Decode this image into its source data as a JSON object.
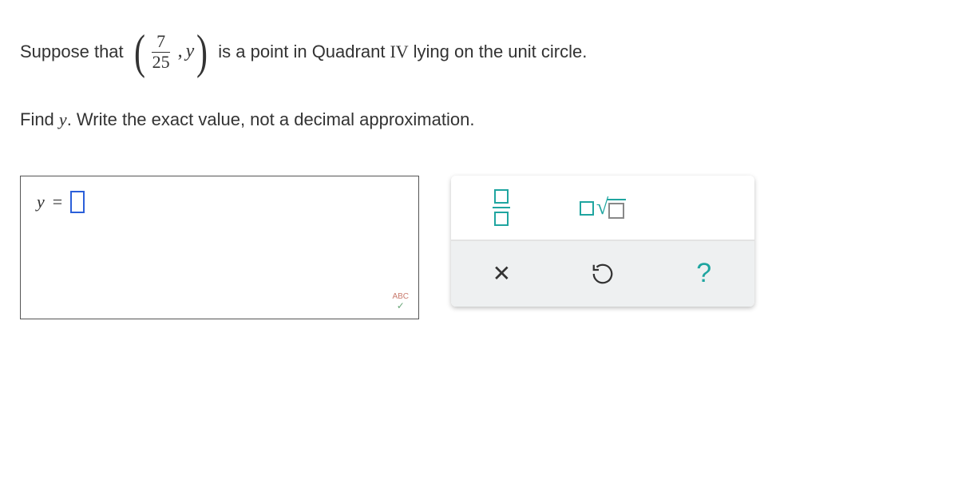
{
  "problem": {
    "prefix": "Suppose that",
    "fraction": {
      "numerator": "7",
      "denominator": "25"
    },
    "comma": ",",
    "y_var": "y",
    "suffix_a": "is a point in Quadrant",
    "quadrant": "IV",
    "suffix_b": "lying on the unit circle.",
    "line2_a": "Find",
    "line2_var": "y",
    "line2_b": ". Write the exact value, not a decimal approximation."
  },
  "answer": {
    "lhs_var": "y",
    "equals": "="
  },
  "abc": {
    "label": "ABC",
    "check": "✓"
  },
  "tools": {
    "clear": "✕",
    "reset": "↶",
    "help": "?"
  }
}
